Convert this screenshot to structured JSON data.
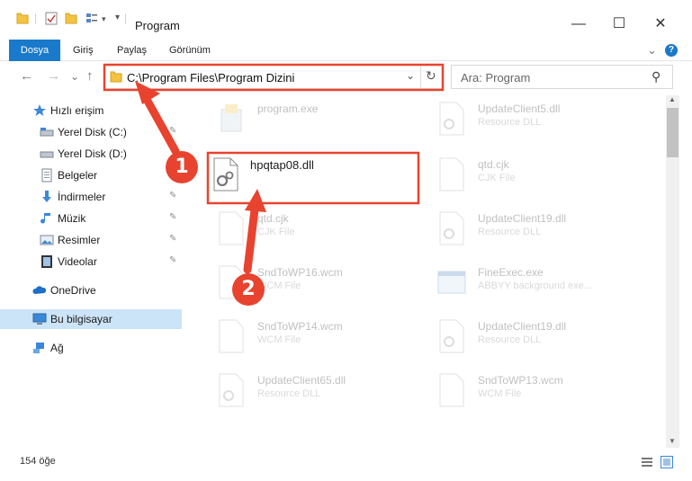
{
  "window": {
    "title": "Program",
    "minimize_glyph": "—",
    "maximize_glyph": "☐",
    "close_glyph": "✕"
  },
  "ribbon": {
    "tabs": [
      "Dosya",
      "Giriş",
      "Paylaş",
      "Görünüm"
    ],
    "expand_glyph": "⌄",
    "help_glyph": "?"
  },
  "nav": {
    "back_glyph": "←",
    "forward_glyph": "→",
    "recent_glyph": "⌄",
    "up_glyph": "↑"
  },
  "address": {
    "path": "C:\\Program Files\\Program Dizini",
    "dropdown_glyph": "⌄",
    "refresh_glyph": "↻"
  },
  "search": {
    "placeholder": "Ara: Program",
    "icon_glyph": "⚲"
  },
  "sidebar": {
    "items": [
      {
        "label": "Hızlı erişim",
        "icon": "star-icon"
      },
      {
        "label": "Yerel Disk (C:)",
        "icon": "drive-icon",
        "pinned": true
      },
      {
        "label": "Yerel Disk (D:)",
        "icon": "drive-icon"
      },
      {
        "label": "Belgeler",
        "icon": "documents-icon",
        "pinned": true
      },
      {
        "label": "İndirmeler",
        "icon": "downloads-icon",
        "pinned": true
      },
      {
        "label": "Müzik",
        "icon": "music-icon",
        "pinned": true
      },
      {
        "label": "Resimler",
        "icon": "pictures-icon",
        "pinned": true
      },
      {
        "label": "Videolar",
        "icon": "videos-icon",
        "pinned": true
      },
      {
        "label": "OneDrive",
        "icon": "cloud-icon"
      },
      {
        "label": "Bu bilgisayar",
        "icon": "computer-icon",
        "selected": true
      },
      {
        "label": "Ağ",
        "icon": "network-icon"
      }
    ],
    "pin_glyph": "📌"
  },
  "files": [
    {
      "name": "program.exe",
      "type": "",
      "icon": "exe-icon"
    },
    {
      "name": "UpdateClient5.dll",
      "type": "Resource DLL",
      "icon": "dll-icon"
    },
    {
      "name": "hpqtap08.dll",
      "type": "",
      "icon": "dll-icon",
      "highlight": true
    },
    {
      "name": "qtd.cjk",
      "type": "CJK File",
      "icon": "file-icon"
    },
    {
      "name": "qtd.cjk",
      "type": "CJK File",
      "icon": "file-icon"
    },
    {
      "name": "UpdateClient19.dll",
      "type": "Resource DLL",
      "icon": "dll-icon"
    },
    {
      "name": "SndToWP16.wcm",
      "type": "WCM File",
      "icon": "file-icon"
    },
    {
      "name": "FineExec.exe",
      "type": "ABBYY background exe...",
      "icon": "app-icon"
    },
    {
      "name": "SndToWP14.wcm",
      "type": "WCM File",
      "icon": "file-icon"
    },
    {
      "name": "UpdateClient19.dll",
      "type": "Resource DLL",
      "icon": "dll-icon"
    },
    {
      "name": "UpdateClient65.dll",
      "type": "Resource DLL",
      "icon": "dll-icon"
    },
    {
      "name": "SndToWP13.wcm",
      "type": "WCM File",
      "icon": "file-icon"
    }
  ],
  "status": {
    "count": "154 öğe"
  },
  "annotations": {
    "step1": "1",
    "step2": "2",
    "accent_color": "#e8432f"
  }
}
